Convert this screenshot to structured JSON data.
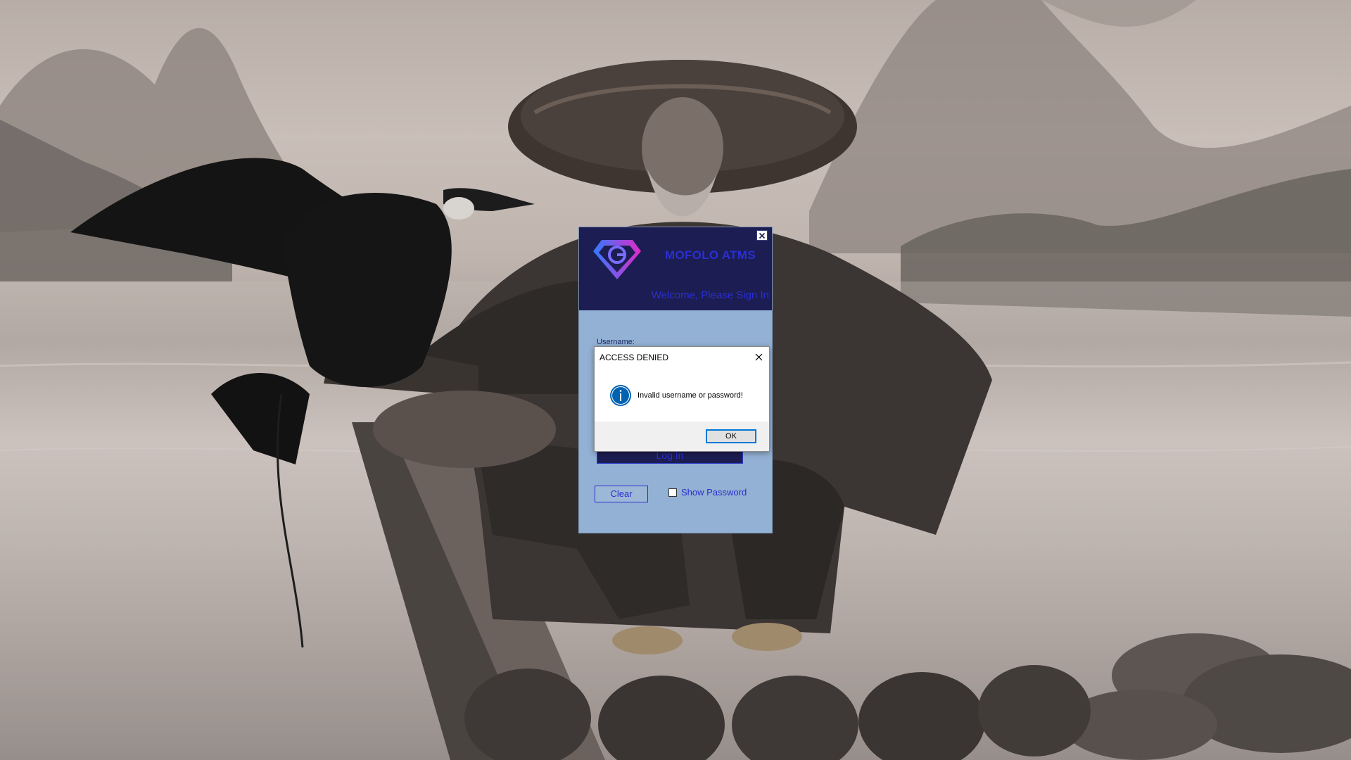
{
  "login": {
    "app_title": "MOFOLO ATMS",
    "welcome": "Welcome, Please Sign In",
    "username_label": "Username:",
    "login_button": "Log In",
    "clear_button": "Clear",
    "show_password_label": "Show Password",
    "show_password_checked": false
  },
  "dialog": {
    "title": "ACCESS DENIED",
    "message": "Invalid username or password!",
    "ok_button": "OK"
  },
  "icons": {
    "logo": "diamond-logo-icon",
    "window_close": "close-icon",
    "dialog_close": "close-icon",
    "info": "info-icon"
  },
  "colors": {
    "header_bg": "#1c1d52",
    "form_bg": "#93b1d4",
    "accent_text": "#2b2fcf",
    "info_blue": "#0063b1",
    "ok_focus": "#0078d7"
  }
}
